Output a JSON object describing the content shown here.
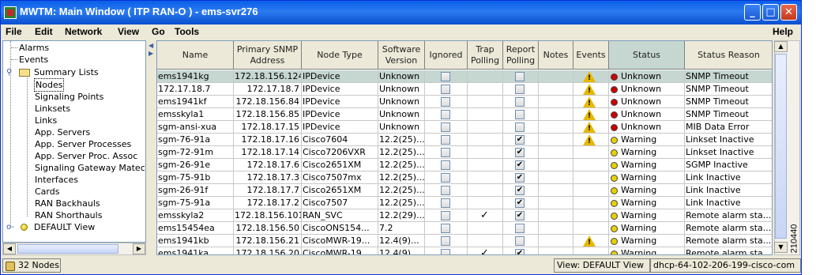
{
  "window": {
    "title": "MWTM: Main Window ( ITP RAN-O )  - ems-svr276",
    "controls": {
      "minimize": "_",
      "maximize": "□",
      "close": "✕"
    }
  },
  "menu": [
    {
      "label": "File"
    },
    {
      "label": "Edit"
    },
    {
      "label": "Network"
    },
    {
      "label": "View"
    },
    {
      "label": "Go"
    },
    {
      "label": "Tools"
    },
    {
      "label": "Help"
    }
  ],
  "tree": {
    "alarms": "Alarms",
    "events": "Events",
    "summary_lists": "Summary Lists",
    "items": [
      "Nodes",
      "Signaling Points",
      "Linksets",
      "Links",
      "App. Servers",
      "App. Server Processes",
      "App. Server Proc. Assoc",
      "Signaling Gateway Matec",
      "Interfaces",
      "Cards",
      "RAN Backhauls",
      "RAN Shorthauls"
    ],
    "selected": "Nodes",
    "default_view": "DEFAULT View"
  },
  "table": {
    "columns": [
      "Name",
      "Primary SNMP Address",
      "Node Type",
      "Software Version",
      "Ignored",
      "Trap Polling",
      "Report Polling",
      "Notes",
      "Events",
      "Status",
      "Status Reason"
    ],
    "sorted_column": "Status",
    "rows": [
      {
        "name": "ems1941kg",
        "ip": "172.18.156.124",
        "type": "IPDevice",
        "ver": "Unknown",
        "trap": false,
        "report": false,
        "event": true,
        "status": "Unknown",
        "reason": "SNMP Timeout",
        "selected": true
      },
      {
        "name": "172.17.18.7",
        "ip": "172.17.18.7",
        "type": "IPDevice",
        "ver": "Unknown",
        "trap": false,
        "report": false,
        "event": true,
        "status": "Unknown",
        "reason": "SNMP Timeout"
      },
      {
        "name": "ems1941kf",
        "ip": "172.18.156.84",
        "type": "IPDevice",
        "ver": "Unknown",
        "trap": false,
        "report": false,
        "event": true,
        "status": "Unknown",
        "reason": "SNMP Timeout"
      },
      {
        "name": "emsskyla1",
        "ip": "172.18.156.85",
        "type": "IPDevice",
        "ver": "Unknown",
        "trap": false,
        "report": false,
        "event": true,
        "status": "Unknown",
        "reason": "SNMP Timeout"
      },
      {
        "name": "sgm-ansi-xua",
        "ip": "172.18.17.15",
        "type": "IPDevice",
        "ver": "Unknown",
        "trap": false,
        "report": false,
        "event": true,
        "status": "Unknown",
        "reason": "MIB Data Error"
      },
      {
        "name": "sgm-76-91a",
        "ip": "172.18.17.16",
        "type": "Cisco7604",
        "ver": "12.2(25)...",
        "trap": false,
        "report": true,
        "event": true,
        "status": "Warning",
        "reason": "Linkset Inactive"
      },
      {
        "name": "sgm-72-91m",
        "ip": "172.18.17.14",
        "type": "Cisco7206VXR",
        "ver": "12.2(25)...",
        "trap": false,
        "report": true,
        "event": false,
        "status": "Warning",
        "reason": "Linkset Inactive"
      },
      {
        "name": "sgm-26-91e",
        "ip": "172.18.17.6",
        "type": "Cisco2651XM",
        "ver": "12.2(25)...",
        "trap": false,
        "report": true,
        "event": false,
        "status": "Warning",
        "reason": "SGMP Inactive"
      },
      {
        "name": "sgm-75-91b",
        "ip": "172.18.17.3",
        "type": "Cisco7507mx",
        "ver": "12.2(25)...",
        "trap": false,
        "report": true,
        "event": false,
        "status": "Warning",
        "reason": "Link Inactive"
      },
      {
        "name": "sgm-26-91f",
        "ip": "172.18.17.7",
        "type": "Cisco2651XM",
        "ver": "12.2(25)...",
        "trap": false,
        "report": true,
        "event": false,
        "status": "Warning",
        "reason": "Link Inactive"
      },
      {
        "name": "sgm-75-91a",
        "ip": "172.18.17.2",
        "type": "Cisco7507",
        "ver": "12.2(25)...",
        "trap": false,
        "report": true,
        "event": false,
        "status": "Warning",
        "reason": "Link Inactive"
      },
      {
        "name": "emsskyla2",
        "ip": "172.18.156.101",
        "type": "RAN_SVC",
        "ver": "12.2(29)...",
        "trap": true,
        "report": true,
        "event": false,
        "status": "Warning",
        "reason": "Remote alarm sta..."
      },
      {
        "name": "ems15454ea",
        "ip": "172.18.156.50",
        "type": "CiscoONS154...",
        "ver": "7.2",
        "trap": false,
        "report": false,
        "event": false,
        "status": "Warning",
        "reason": "Remote alarm sta..."
      },
      {
        "name": "ems1941kb",
        "ip": "172.18.156.21",
        "type": "CiscoMWR-19...",
        "ver": "12.4(9)...",
        "trap": false,
        "report": false,
        "event": true,
        "status": "Warning",
        "reason": "Remote alarm sta..."
      },
      {
        "name": "ems1941ka",
        "ip": "172.18.156.20",
        "type": "CiscoMWR-19...",
        "ver": "12.4(9)...",
        "trap": true,
        "report": true,
        "event": false,
        "status": "Warning",
        "reason": "Remote alarm sta..."
      }
    ]
  },
  "statusbar": {
    "count": "32 Nodes",
    "view": "View: DEFAULT View",
    "host": "dhcp-64-102-206-199-cisco-com"
  },
  "side_number": "210440",
  "colors": {
    "unknown": "#cc0000",
    "warning": "#e8d000",
    "selected_row": "#c6d7d2"
  }
}
